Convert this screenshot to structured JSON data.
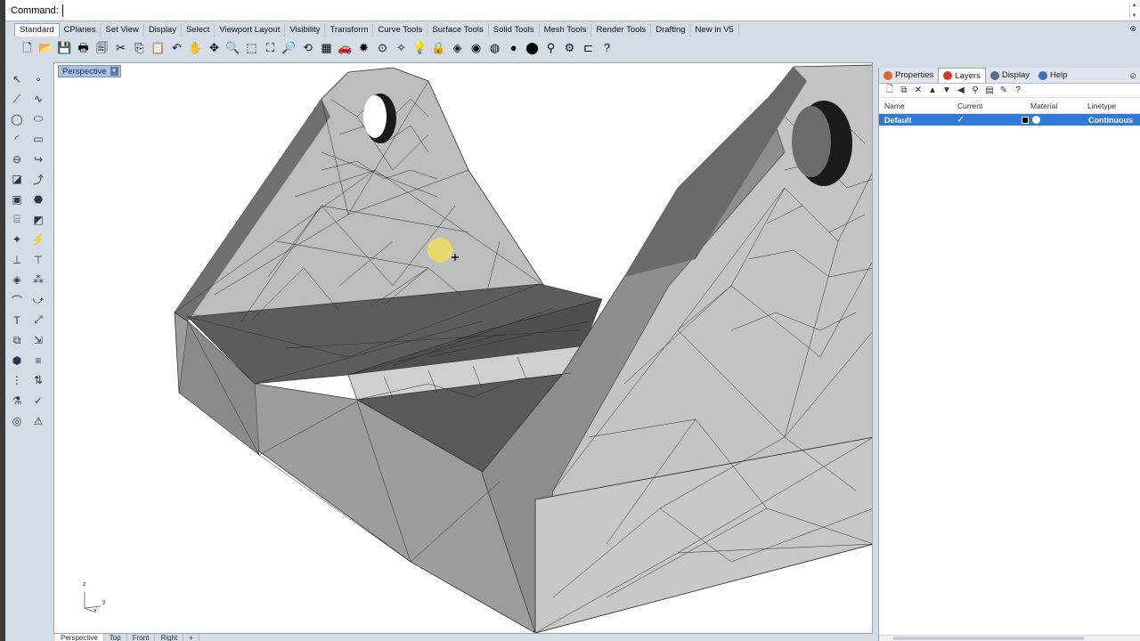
{
  "command": {
    "label": "Command:",
    "value": ""
  },
  "tabs": [
    {
      "label": "Standard",
      "active": true
    },
    {
      "label": "CPlanes"
    },
    {
      "label": "Set View"
    },
    {
      "label": "Display"
    },
    {
      "label": "Select"
    },
    {
      "label": "Viewport Layout"
    },
    {
      "label": "Visibility"
    },
    {
      "label": "Transform"
    },
    {
      "label": "Curve Tools"
    },
    {
      "label": "Surface Tools"
    },
    {
      "label": "Solid Tools"
    },
    {
      "label": "Mesh Tools"
    },
    {
      "label": "Render Tools"
    },
    {
      "label": "Drafting"
    },
    {
      "label": "New in V5"
    }
  ],
  "toolbar_icons": [
    {
      "name": "new-icon",
      "glyph": "🗋"
    },
    {
      "name": "open-icon",
      "glyph": "📂"
    },
    {
      "name": "save-icon",
      "glyph": "💾"
    },
    {
      "name": "print-icon",
      "glyph": "🖶"
    },
    {
      "name": "import-icon",
      "glyph": "🗐"
    },
    {
      "name": "cut-icon",
      "glyph": "✂"
    },
    {
      "name": "copy-icon",
      "glyph": "⎘"
    },
    {
      "name": "paste-icon",
      "glyph": "📋"
    },
    {
      "name": "undo-icon",
      "glyph": "↶"
    },
    {
      "name": "pan-icon",
      "glyph": "✋"
    },
    {
      "name": "rotate-view-icon",
      "glyph": "✥"
    },
    {
      "name": "zoom-icon",
      "glyph": "🔍"
    },
    {
      "name": "zoom-window-icon",
      "glyph": "⬚"
    },
    {
      "name": "zoom-extents-icon",
      "glyph": "⛶"
    },
    {
      "name": "zoom-selected-icon",
      "glyph": "🔎"
    },
    {
      "name": "undo-view-icon",
      "glyph": "⟲"
    },
    {
      "name": "grid-icon",
      "glyph": "▦"
    },
    {
      "name": "car-icon",
      "glyph": "🚗"
    },
    {
      "name": "light-icon",
      "glyph": "✹"
    },
    {
      "name": "select-icon",
      "glyph": "⊙"
    },
    {
      "name": "analyze-icon",
      "glyph": "✧"
    },
    {
      "name": "lightbulb-icon",
      "glyph": "💡"
    },
    {
      "name": "lock-icon",
      "glyph": "🔒"
    },
    {
      "name": "layer-icon",
      "glyph": "◈"
    },
    {
      "name": "color-wheel-icon",
      "glyph": "◉"
    },
    {
      "name": "render-preview-icon",
      "glyph": "◍"
    },
    {
      "name": "shaded-icon",
      "glyph": "●"
    },
    {
      "name": "render-icon",
      "glyph": "⬤"
    },
    {
      "name": "filter-icon",
      "glyph": "⚲"
    },
    {
      "name": "options-icon",
      "glyph": "⚙"
    },
    {
      "name": "dimension-icon",
      "glyph": "⊏"
    },
    {
      "name": "help-icon",
      "glyph": "?"
    }
  ],
  "left_tools": [
    {
      "name": "select-arrow-icon",
      "glyph": "↖"
    },
    {
      "name": "point-icon",
      "glyph": "∘"
    },
    {
      "name": "polyline-icon",
      "glyph": "⟋"
    },
    {
      "name": "curve-icon",
      "glyph": "∿"
    },
    {
      "name": "circle-icon",
      "glyph": "◯"
    },
    {
      "name": "ellipse-icon",
      "glyph": "⬭"
    },
    {
      "name": "arc-icon",
      "glyph": "◜"
    },
    {
      "name": "rectangle-icon",
      "glyph": "▭"
    },
    {
      "name": "curve-fillet-icon",
      "glyph": "⊖"
    },
    {
      "name": "offset-curve-icon",
      "glyph": "↪"
    },
    {
      "name": "surface-icon",
      "glyph": "◪"
    },
    {
      "name": "extrude-curve-icon",
      "glyph": "⤴"
    },
    {
      "name": "box-icon",
      "glyph": "▣"
    },
    {
      "name": "sphere-icon",
      "glyph": "⬣"
    },
    {
      "name": "cylinder-icon",
      "glyph": "⌸"
    },
    {
      "name": "plane-icon",
      "glyph": "◩"
    },
    {
      "name": "solid-tools-icon",
      "glyph": "✦"
    },
    {
      "name": "boolean-icon",
      "glyph": "⚡"
    },
    {
      "name": "split-icon",
      "glyph": "⊥"
    },
    {
      "name": "trim-icon",
      "glyph": "⊤"
    },
    {
      "name": "mesh-icon",
      "glyph": "◈"
    },
    {
      "name": "explode-icon",
      "glyph": "⁂"
    },
    {
      "name": "fillet-icon",
      "glyph": "⌒"
    },
    {
      "name": "blend-icon",
      "glyph": "⤻"
    },
    {
      "name": "text-icon",
      "glyph": "T"
    },
    {
      "name": "dimension-tool-icon",
      "glyph": "⤢"
    },
    {
      "name": "group-icon",
      "glyph": "⧉"
    },
    {
      "name": "move-icon",
      "glyph": "⇲"
    },
    {
      "name": "block-icon",
      "glyph": "⬢"
    },
    {
      "name": "array-icon",
      "glyph": "≡"
    },
    {
      "name": "array-grid-icon",
      "glyph": "⋮"
    },
    {
      "name": "mirror-icon",
      "glyph": "⇅"
    },
    {
      "name": "analyze-tool-icon",
      "glyph": "⚗"
    },
    {
      "name": "check-icon",
      "glyph": "✓"
    },
    {
      "name": "render-tool-icon",
      "glyph": "◎"
    },
    {
      "name": "warning-icon",
      "glyph": "⚠"
    }
  ],
  "viewport": {
    "title": "Perspective"
  },
  "axis": {
    "z": "z",
    "x": "x",
    "y": "y"
  },
  "viewport_tabs": [
    "Perspective",
    "Top",
    "Front",
    "Right",
    "+"
  ],
  "panel": {
    "tabs": [
      {
        "label": "Properties",
        "color": "#e0662a"
      },
      {
        "label": "Layers",
        "color": "#d23a2a",
        "active": true
      },
      {
        "label": "Display",
        "color": "#5a6a8a"
      },
      {
        "label": "Help",
        "color": "#3b6fc4"
      }
    ],
    "toolbar": [
      {
        "name": "new-layer-icon",
        "glyph": "🗋"
      },
      {
        "name": "new-sublayer-icon",
        "glyph": "⧉"
      },
      {
        "name": "delete-layer-icon",
        "glyph": "✕"
      },
      {
        "name": "move-up-icon",
        "glyph": "▲"
      },
      {
        "name": "move-down-icon",
        "glyph": "▼"
      },
      {
        "name": "move-parent-icon",
        "glyph": "◀"
      },
      {
        "name": "filter-layer-icon",
        "glyph": "⚲"
      },
      {
        "name": "layer-tools-icon",
        "glyph": "▤"
      },
      {
        "name": "settings-wrench-icon",
        "glyph": "✎"
      },
      {
        "name": "layer-help-icon",
        "glyph": "?"
      }
    ],
    "columns": {
      "name": "Name",
      "current": "Current",
      "material": "Material",
      "linetype": "Linetype"
    },
    "layers": [
      {
        "name": "Default",
        "current": "✓",
        "color": "#000000",
        "linetype": "Continuous"
      }
    ]
  }
}
